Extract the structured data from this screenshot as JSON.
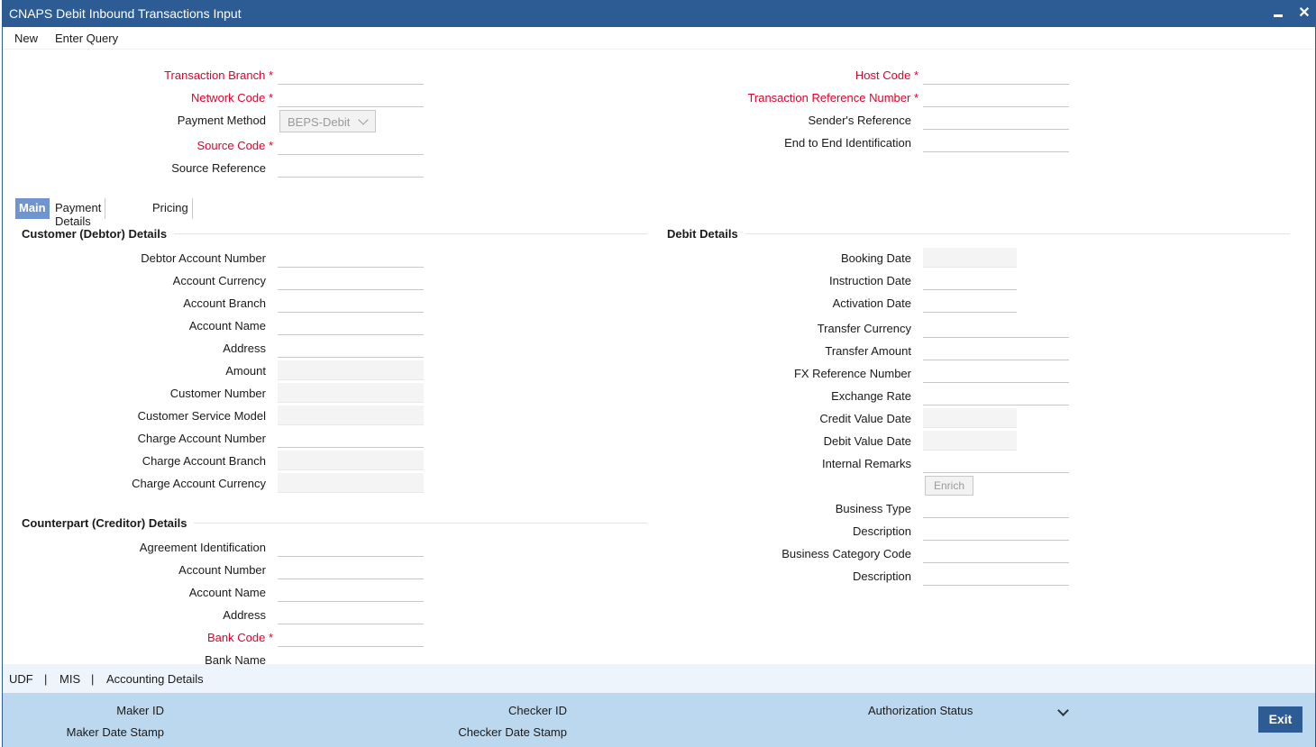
{
  "window": {
    "title": "CNAPS Debit Inbound Transactions Input"
  },
  "menu": {
    "new": "New",
    "enter_query": "Enter Query"
  },
  "header": {
    "transaction_branch": "Transaction Branch",
    "network_code": "Network Code",
    "payment_method": "Payment Method",
    "payment_method_value": "BEPS-Debit",
    "source_code": "Source Code",
    "source_reference": "Source Reference",
    "host_code": "Host Code",
    "transaction_reference_number": "Transaction Reference Number",
    "senders_reference": "Sender's Reference",
    "end_to_end_identification": "End to End Identification"
  },
  "tabs": {
    "main": "Main",
    "payment_details": "Payment Details",
    "pricing": "Pricing"
  },
  "debtor": {
    "title": "Customer (Debtor) Details",
    "debtor_account_number": "Debtor Account Number",
    "account_currency": "Account Currency",
    "account_branch": "Account Branch",
    "account_name": "Account Name",
    "address": "Address",
    "amount": "Amount",
    "customer_number": "Customer Number",
    "customer_service_model": "Customer Service Model",
    "charge_account_number": "Charge Account Number",
    "charge_account_branch": "Charge Account Branch",
    "charge_account_currency": "Charge Account Currency"
  },
  "creditor": {
    "title": "Counterpart (Creditor) Details",
    "agreement_identification": "Agreement Identification",
    "account_number": "Account Number",
    "account_name": "Account Name",
    "address": "Address",
    "bank_code": "Bank Code",
    "bank_name": "Bank Name"
  },
  "debit": {
    "title": "Debit Details",
    "booking_date": "Booking Date",
    "instruction_date": "Instruction Date",
    "activation_date": "Activation Date",
    "transfer_currency": "Transfer Currency",
    "transfer_amount": "Transfer Amount",
    "fx_reference_number": "FX Reference Number",
    "exchange_rate": "Exchange Rate",
    "credit_value_date": "Credit Value Date",
    "debit_value_date": "Debit Value Date",
    "internal_remarks": "Internal Remarks",
    "enrich": "Enrich",
    "business_type": "Business Type",
    "description1": "Description",
    "business_category_code": "Business Category Code",
    "description2": "Description"
  },
  "links": {
    "udf": "UDF",
    "sep1": "|",
    "mis": "MIS",
    "sep2": "|",
    "accounting_details": "Accounting Details"
  },
  "footer": {
    "maker_id": "Maker ID",
    "maker_date_stamp": "Maker Date Stamp",
    "checker_id": "Checker ID",
    "checker_date_stamp": "Checker Date Stamp",
    "authorization_status": "Authorization Status",
    "exit": "Exit"
  }
}
